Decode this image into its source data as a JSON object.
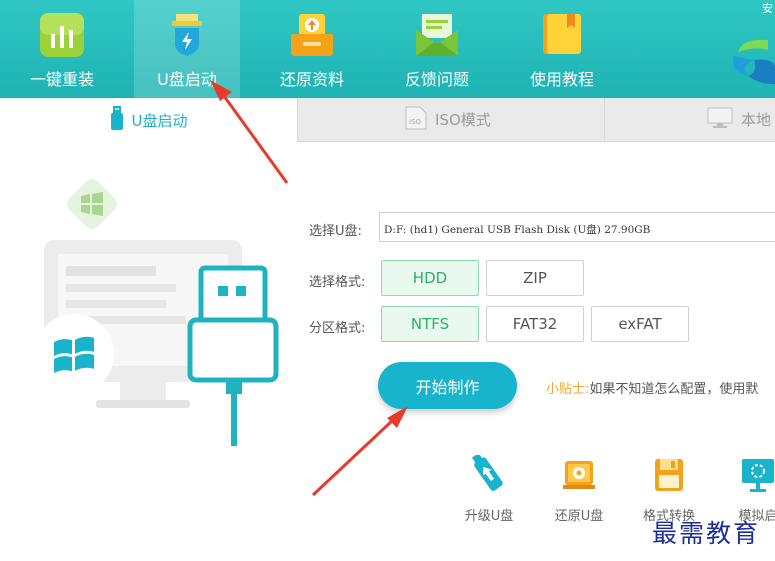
{
  "corner_text": "安",
  "nav": [
    {
      "label": "一键重装",
      "icon": "bar-chart-icon"
    },
    {
      "label": "U盘启动",
      "icon": "usb-shield-icon",
      "active": true
    },
    {
      "label": "还原资料",
      "icon": "restore-box-icon"
    },
    {
      "label": "反馈问题",
      "icon": "envelope-icon"
    },
    {
      "label": "使用教程",
      "icon": "book-icon"
    }
  ],
  "subtabs": [
    {
      "label": "U盘启动",
      "active": true
    },
    {
      "label": "ISO模式"
    },
    {
      "label": "本地"
    }
  ],
  "form": {
    "usb_label": "选择U盘:",
    "usb_value": "D:F: (hd1) General USB Flash Disk  (U盘) 27.90GB",
    "format_label": "选择格式:",
    "format_options": [
      "HDD",
      "ZIP"
    ],
    "format_selected": "HDD",
    "partition_label": "分区格式:",
    "partition_options": [
      "NTFS",
      "FAT32",
      "exFAT"
    ],
    "partition_selected": "NTFS",
    "start_button": "开始制作",
    "tip_key": "小贴士:",
    "tip_text": "如果不知道怎么配置，使用默"
  },
  "tools": [
    {
      "label": "升级U盘",
      "icon": "usb-upgrade-icon"
    },
    {
      "label": "还原U盘",
      "icon": "restore-usb-icon"
    },
    {
      "label": "格式转换",
      "icon": "floppy-icon"
    },
    {
      "label": "模拟启",
      "icon": "simulate-monitor-icon"
    }
  ],
  "watermark": "最需教育",
  "colors": {
    "teal": "#1fb3b4",
    "accent": "#17b4cc",
    "selected_green": "#2fae68",
    "tip_orange": "#f0a535",
    "arrow_red": "#e83a2b"
  }
}
